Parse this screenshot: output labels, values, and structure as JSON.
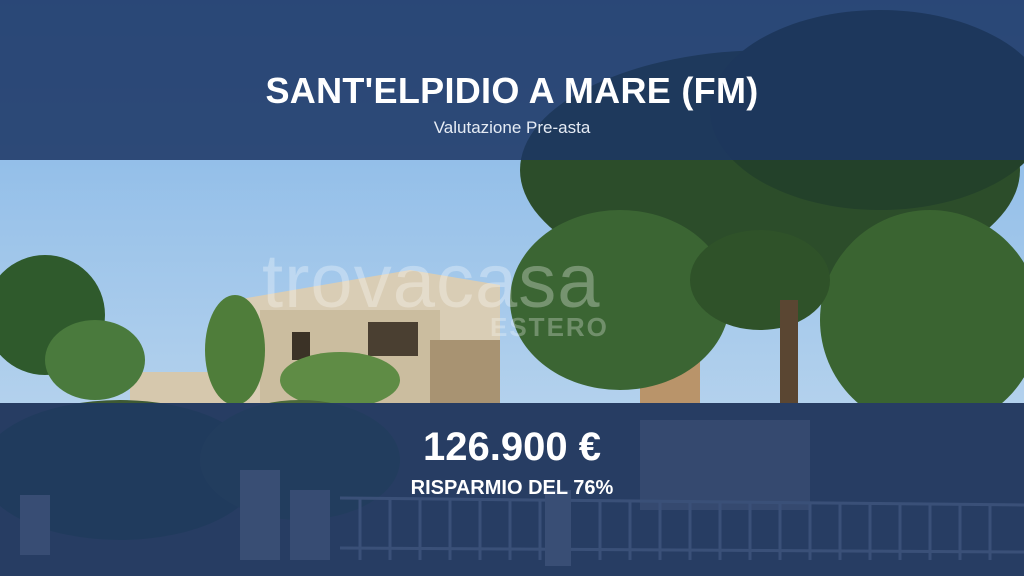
{
  "header": {
    "title": "SANT'ELPIDIO A MARE (FM)",
    "subtitle": "Valutazione Pre-asta"
  },
  "footer": {
    "price": "126.900 €",
    "saving": "RISPARMIO DEL 76%"
  },
  "watermark": {
    "logo": "trovacasa",
    "sub": "ESTERO"
  },
  "colors": {
    "band": "#1c3664",
    "text": "#ffffff",
    "sky": "#9fc6ea"
  }
}
